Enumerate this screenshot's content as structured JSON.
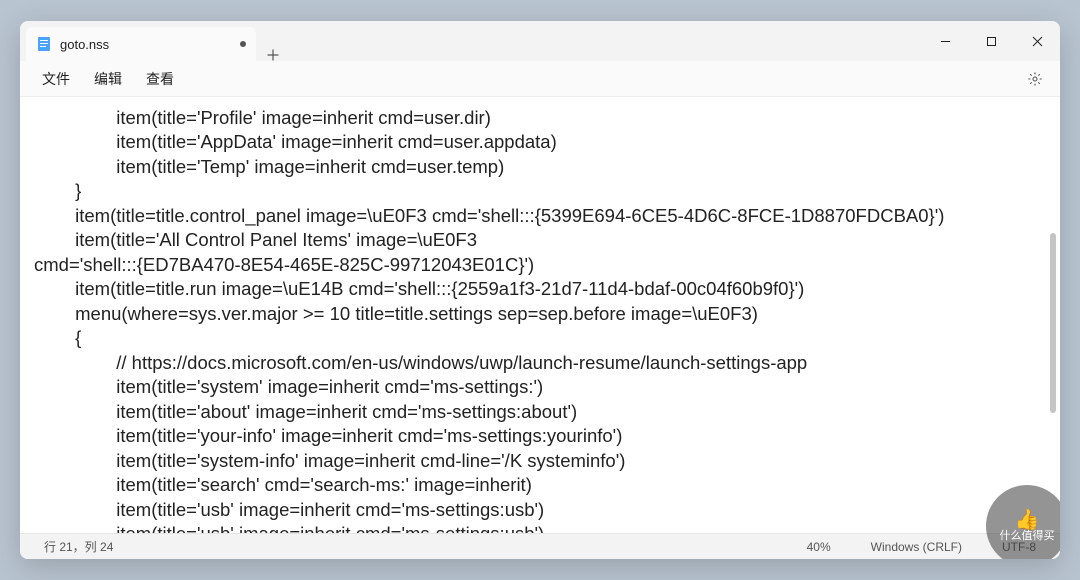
{
  "tab": {
    "title": "goto.nss",
    "modified": true
  },
  "menus": {
    "file": "文件",
    "edit": "编辑",
    "view": "查看"
  },
  "code": {
    "l01": "                item(title='Profile' image=inherit cmd=user.dir)",
    "l02": "                item(title='AppData' image=inherit cmd=user.appdata)",
    "l03": "                item(title='Temp' image=inherit cmd=user.temp)",
    "l04": "        }",
    "l05": "        item(title=title.control_panel image=\\uE0F3 cmd='shell:::{5399E694-6CE5-4D6C-8FCE-1D8870FDCBA0}')",
    "l06": "        item(title='All Control Panel Items' image=\\uE0F3",
    "l07": "cmd='shell:::{ED7BA470-8E54-465E-825C-99712043E01C}')",
    "l08": "        item(title=title.run image=\\uE14B cmd='shell:::{2559a1f3-21d7-11d4-bdaf-00c04f60b9f0}')",
    "l09": "        menu(where=sys.ver.major >= 10 title=title.settings sep=sep.before image=\\uE0F3)",
    "l10": "        {",
    "l11": "                // https://docs.microsoft.com/en-us/windows/uwp/launch-resume/launch-settings-app",
    "l12": "                item(title='system' image=inherit cmd='ms-settings:')",
    "l13": "                item(title='about' image=inherit cmd='ms-settings:about')",
    "l14": "                item(title='your-info' image=inherit cmd='ms-settings:yourinfo')",
    "l15": "                item(title='system-info' image=inherit cmd-line='/K systeminfo')",
    "l16": "                item(title='search' cmd='search-ms:' image=inherit)",
    "l17": "                item(title='usb' image=inherit cmd='ms-settings:usb')",
    "l18": "                item(title='usb' image=inherit cmd='ms-settings:usb')"
  },
  "status": {
    "position": "行 21，列 24",
    "zoom": "40%",
    "line_ending": "Windows (CRLF)",
    "encoding": "UTF-8"
  },
  "watermark": {
    "line1": "什么值得买"
  }
}
